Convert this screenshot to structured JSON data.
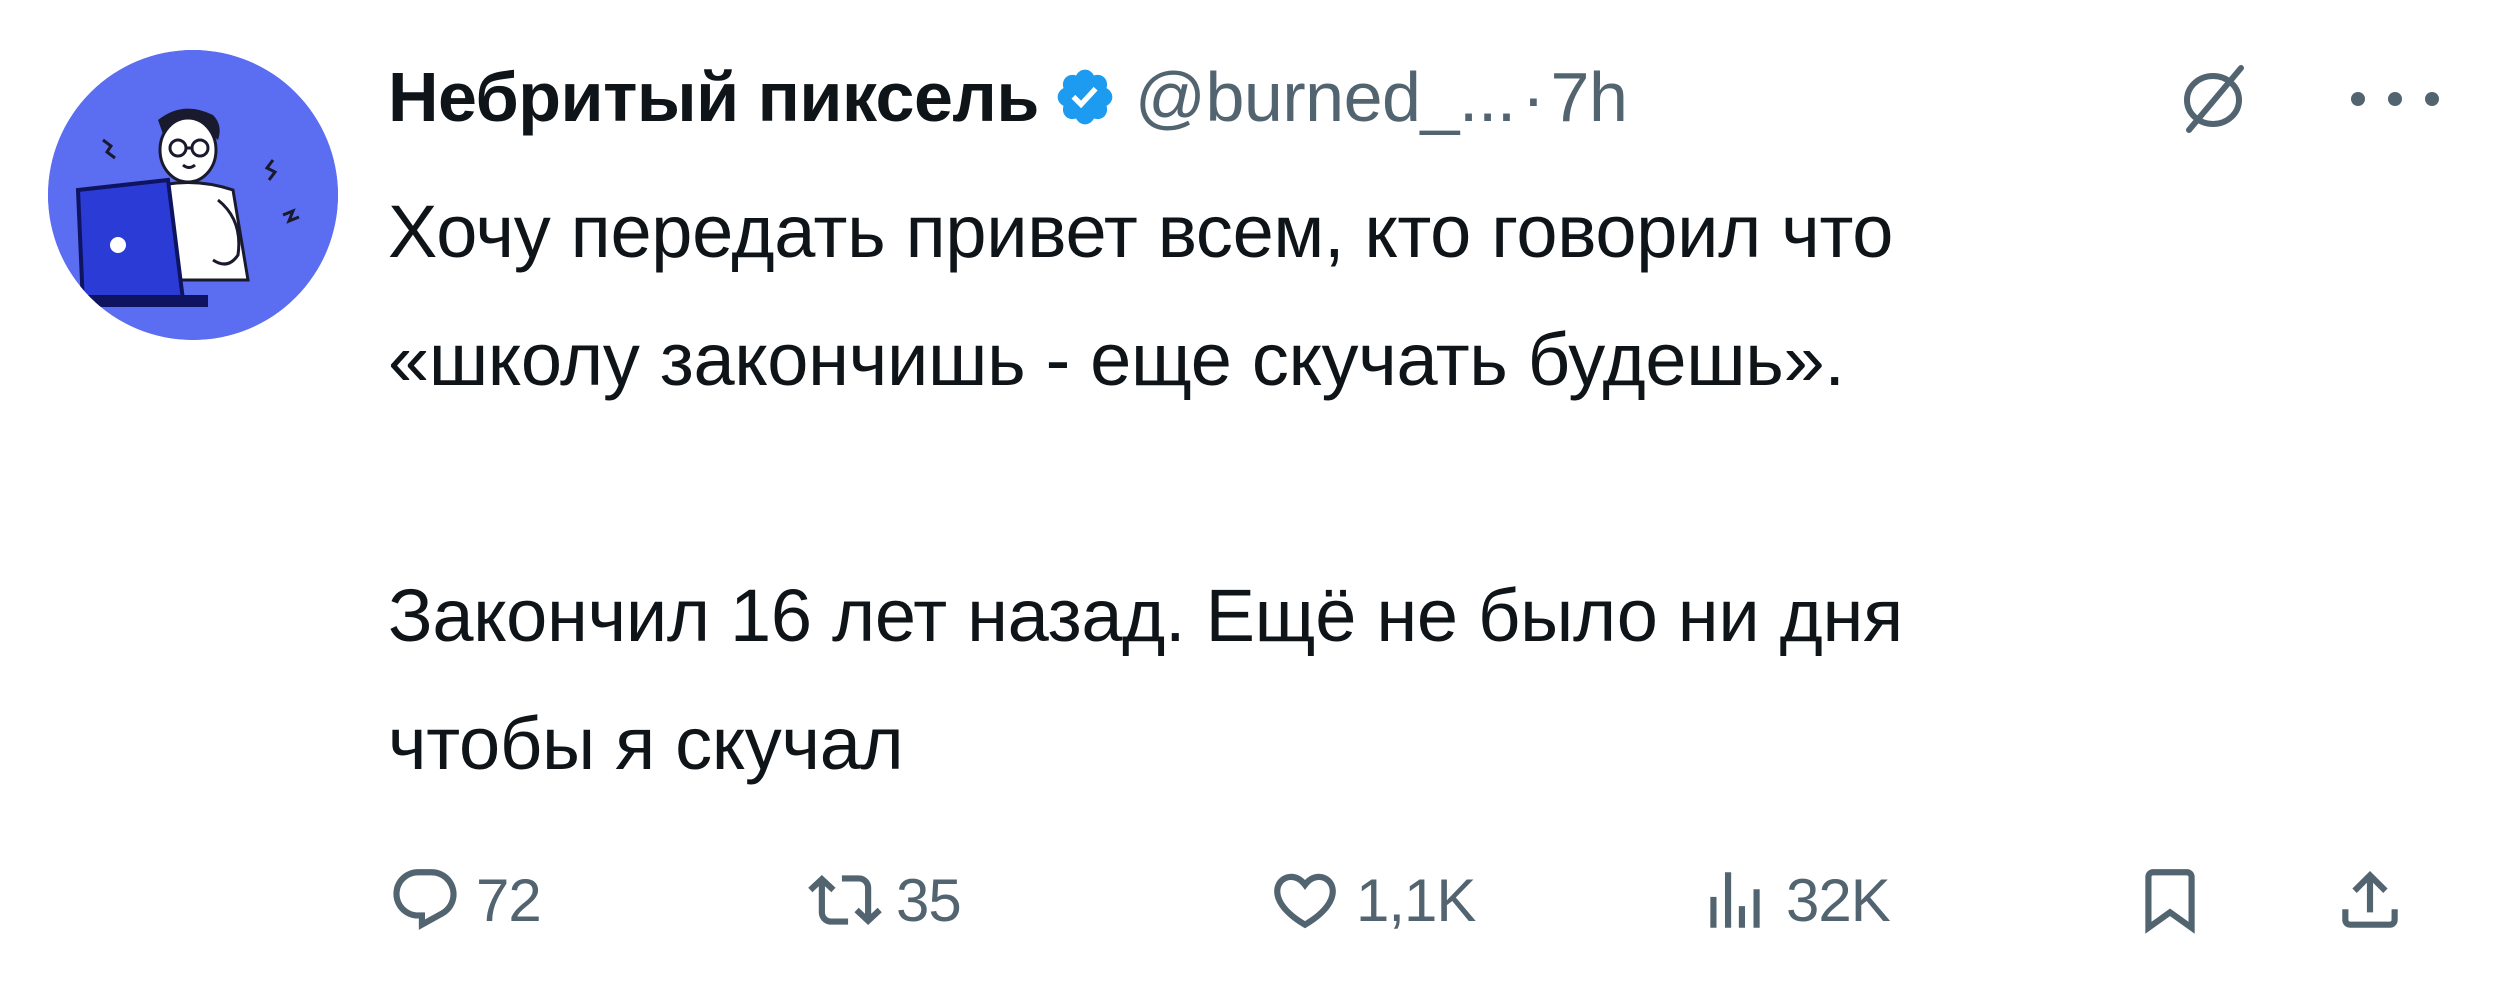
{
  "author": {
    "display_name": "Небритый пиксель",
    "handle": "@burned_...",
    "separator": "·",
    "time": "7h",
    "avatar_bg": "#5b6df0",
    "verified_color": "#1d9bf0"
  },
  "icons": {
    "verified": "verified-badge-icon",
    "grok": "grok-icon",
    "more": "more-icon",
    "reply": "reply-icon",
    "retweet": "retweet-icon",
    "like": "heart-icon",
    "views": "views-icon",
    "bookmark": "bookmark-icon",
    "share": "share-icon"
  },
  "tweet": {
    "paragraph_1": "Хочу передать привет всем, кто говорил что\n«школу закончишь - еще скучать будешь».",
    "paragraph_2": "Закончил 16 лет назад. Ещё не было ни дня\nчтобы я скучал"
  },
  "actions": {
    "replies": "72",
    "retweets": "35",
    "likes": "1,1K",
    "views": "32K"
  },
  "colors": {
    "text": "#0f1419",
    "secondary": "#536471"
  }
}
